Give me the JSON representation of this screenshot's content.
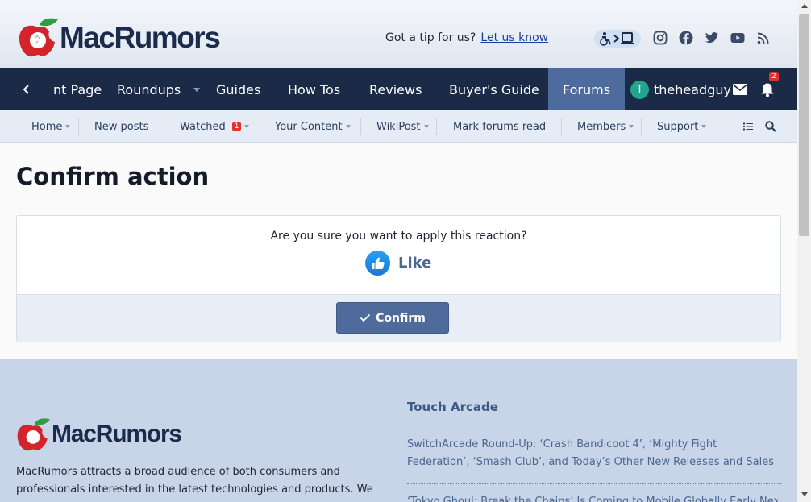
{
  "header": {
    "logo_text": "MacRumors",
    "tip_text": "Got a tip for us?",
    "tip_link": "Let us know"
  },
  "mainnav": {
    "items": [
      {
        "label": "nt Page"
      },
      {
        "label": "Roundups"
      },
      {
        "label": "Guides"
      },
      {
        "label": "How Tos"
      },
      {
        "label": "Reviews"
      },
      {
        "label": "Buyer's Guide"
      },
      {
        "label": "Forums"
      }
    ],
    "username": "theheadguy",
    "avatar_letter": "T",
    "alerts_count": "2"
  },
  "subnav": {
    "items": [
      {
        "label": "Home"
      },
      {
        "label": "New posts"
      },
      {
        "label": "Watched"
      },
      {
        "label": "Your Content"
      },
      {
        "label": "WikiPost"
      },
      {
        "label": "Mark forums read"
      },
      {
        "label": "Members"
      },
      {
        "label": "Support"
      }
    ],
    "watched_count": "1"
  },
  "content": {
    "title": "Confirm action",
    "question": "Are you sure you want to apply this reaction?",
    "reaction_label": "Like",
    "confirm_label": "Confirm"
  },
  "footer": {
    "logo_text": "MacRumors",
    "description": "MacRumors attracts a broad audience of both consumers and professionals interested in the latest technologies and products. We",
    "heading": "Touch Arcade",
    "article1": "SwitchArcade Round-Up: ‘Crash Bandicoot 4’, ‘Mighty Fight Federation’, ‘Smash Club’, and Today’s Other New Releases and Sales",
    "article2": "‘Tokyo Ghoul: Break the Chains’ Is Coming to Mobile Globally Early Next Year"
  },
  "colors": {
    "nav_bg": "#1b2a47",
    "nav_active": "#4d6b9c",
    "accent": "#4e6b9b",
    "footer_bg": "#c8d4e7"
  }
}
